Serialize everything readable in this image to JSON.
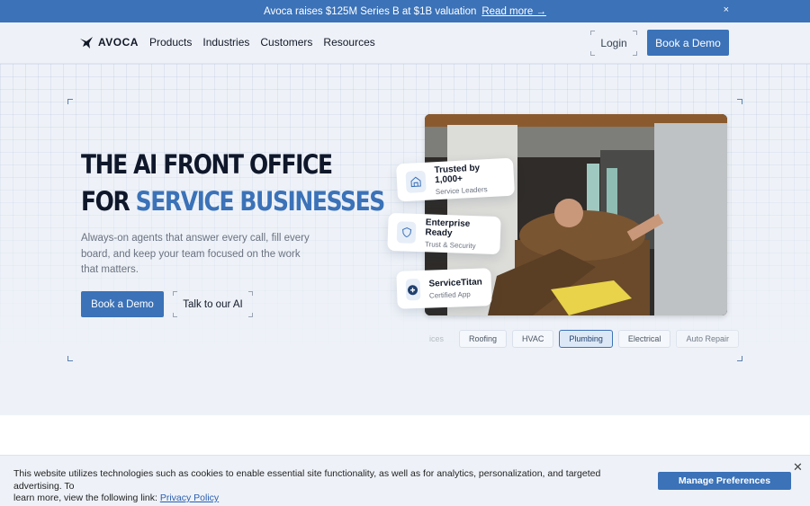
{
  "announcement": {
    "text": "Avoca raises $125M Series B at $1B valuation",
    "link": "Read more →",
    "close": "×"
  },
  "nav": {
    "brand": "AVOCA",
    "links": [
      "Products",
      "Industries",
      "Customers",
      "Resources"
    ],
    "login": "Login",
    "cta": "Book a Demo"
  },
  "hero": {
    "headline_line1": "THE AI FRONT OFFICE",
    "headline_line2_prefix": "FOR ",
    "headline_line2_accent": "SERVICE BUSINESSES",
    "subtitle_lines": [
      "Always-on agents that answer every call, fill every",
      "board, and keep your team focused on the work",
      "that matters."
    ],
    "cta_primary": "Book a Demo",
    "cta_secondary": "Talk to our AI",
    "badges": [
      {
        "title": "Trusted by 1,000+",
        "subtitle": "Service Leaders",
        "icon": "building-icon"
      },
      {
        "title": "Enterprise Ready",
        "subtitle": "Trust & Security",
        "icon": "shield-icon"
      },
      {
        "title": "ServiceTitan",
        "subtitle": "Certified App",
        "icon": "servicetitan-logo-icon"
      }
    ],
    "industries": [
      "ices",
      "Roofing",
      "HVAC",
      "Plumbing",
      "Electrical",
      "Auto Repair"
    ],
    "active_industry": "Plumbing"
  },
  "cookie": {
    "text_line1": "This website utilizes technologies such as cookies to enable essential site functionality, as well as for analytics, personalization, and targeted advertising. To",
    "text_line2_prefix": "learn more, view the following link: ",
    "link": "Privacy Policy",
    "button": "Manage Preferences",
    "close": "✕"
  },
  "colors": {
    "brand_blue": "#3b72b8",
    "background": "#eef2f8",
    "headline": "#0f172a"
  }
}
